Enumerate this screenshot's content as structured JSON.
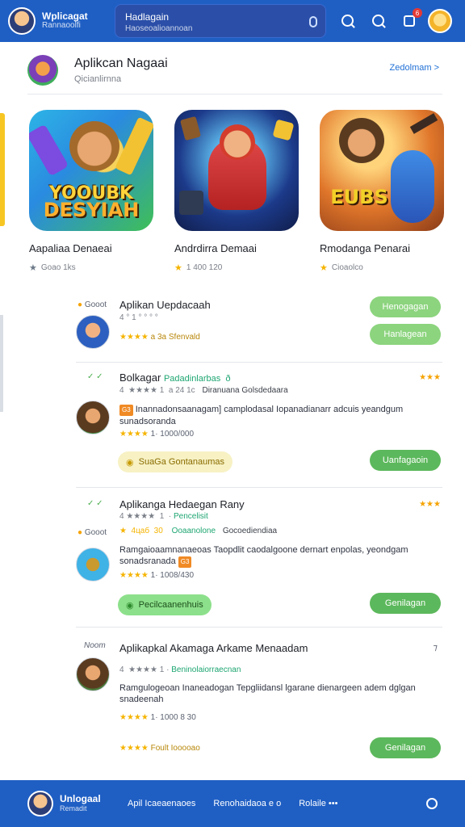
{
  "topbar": {
    "brand_title": "Wplicagat",
    "brand_sub": "Rannaoolfi",
    "search_value": "Hadlagain",
    "search_placeholder": "Haoseoalioannoan",
    "notification_count": "6"
  },
  "featured": {
    "title": "Aplikcan Nagaai",
    "subtitle": "Qicianlirnna",
    "see_all": "Zedolmam >",
    "cards": [
      {
        "art_line1": "YOOUBK",
        "art_line2": "DESYIAH",
        "name": "Aapaliaa Denaeai",
        "meta": "Goao 1ks",
        "star": "grey"
      },
      {
        "art_line1": "",
        "art_line2": "",
        "name": "Andrdirra Demaai",
        "meta": "1 400 120",
        "star": "gold"
      },
      {
        "art_line1": "",
        "art_line2": "EUBS",
        "name": "Rmodanga Penarai",
        "meta": "Cioaolco",
        "star": "gold"
      }
    ]
  },
  "list": [
    {
      "tag": "Gooot",
      "title": "Aplikan Uepdacaah",
      "meta": "4 ° 1 ° ° ° °",
      "rating_stars": "★★★★",
      "rating_text": "a 3a Sfenvald",
      "btn1": "Henogagan",
      "btn2": "Hanlagean"
    },
    {
      "title": "Bolkagar",
      "title_green": "Padadinlarbas  ð",
      "meta_left": "4  ★★★★ 1  a 24 1с",
      "meta_right": "Diranuana Golsdedaara",
      "desc": "Inannadonsaanagam] camplodasal Iopanadianarr adcuis yeandgum sunadsoranda",
      "desc_badge": "G3",
      "rating_stars": "★★★★",
      "rating_text": "1· 1000/000",
      "pill": "SuaGa Gontanaumas",
      "btn": "Uanfagaoin"
    },
    {
      "title": "Aplikanga Hedaegan Rany",
      "tag": "Gooot",
      "meta_left": "4 ★★★★  1  ·",
      "meta_green": "Pencelisit",
      "meta2_left": "★  4цаб  30",
      "meta2_green": "Ooaanolone",
      "meta2_right": "Gocoediendiaa",
      "desc": "Ramgaioaamnanaeoas Taopdlit caodalgoone dernart enpolas, yeondgam sonadsranada",
      "desc_badge": "G3",
      "rating_stars": "★★★★",
      "rating_text": "1· 1008/430",
      "pill": "Pecilcaanenhuis",
      "btn": "Genilagan"
    },
    {
      "tag": "Noom",
      "title": "Aplikapkal Akamaga Arkame Menaadam",
      "meta_left": "4  ★★★★ 1 ·",
      "meta_green": "Beninolaiorraecnan",
      "desc": "Ramgulogeoan Inaneadogan Tepgliidansl lgarane dienargeen adem  dglgan snadeenah",
      "rating_stars": "★★★★",
      "rating_text": "1· 1000 8 30",
      "rating2_stars": "★★★★",
      "rating2_text": "Foult Iooooao",
      "btn": "Genilagan"
    }
  ],
  "bottombar": {
    "brand_title": "Unlogaal",
    "brand_sub": "Remadit",
    "links": [
      "Apil Icaeaenaoes",
      "Renohaidaoa e o",
      "Rolaile •••"
    ]
  }
}
